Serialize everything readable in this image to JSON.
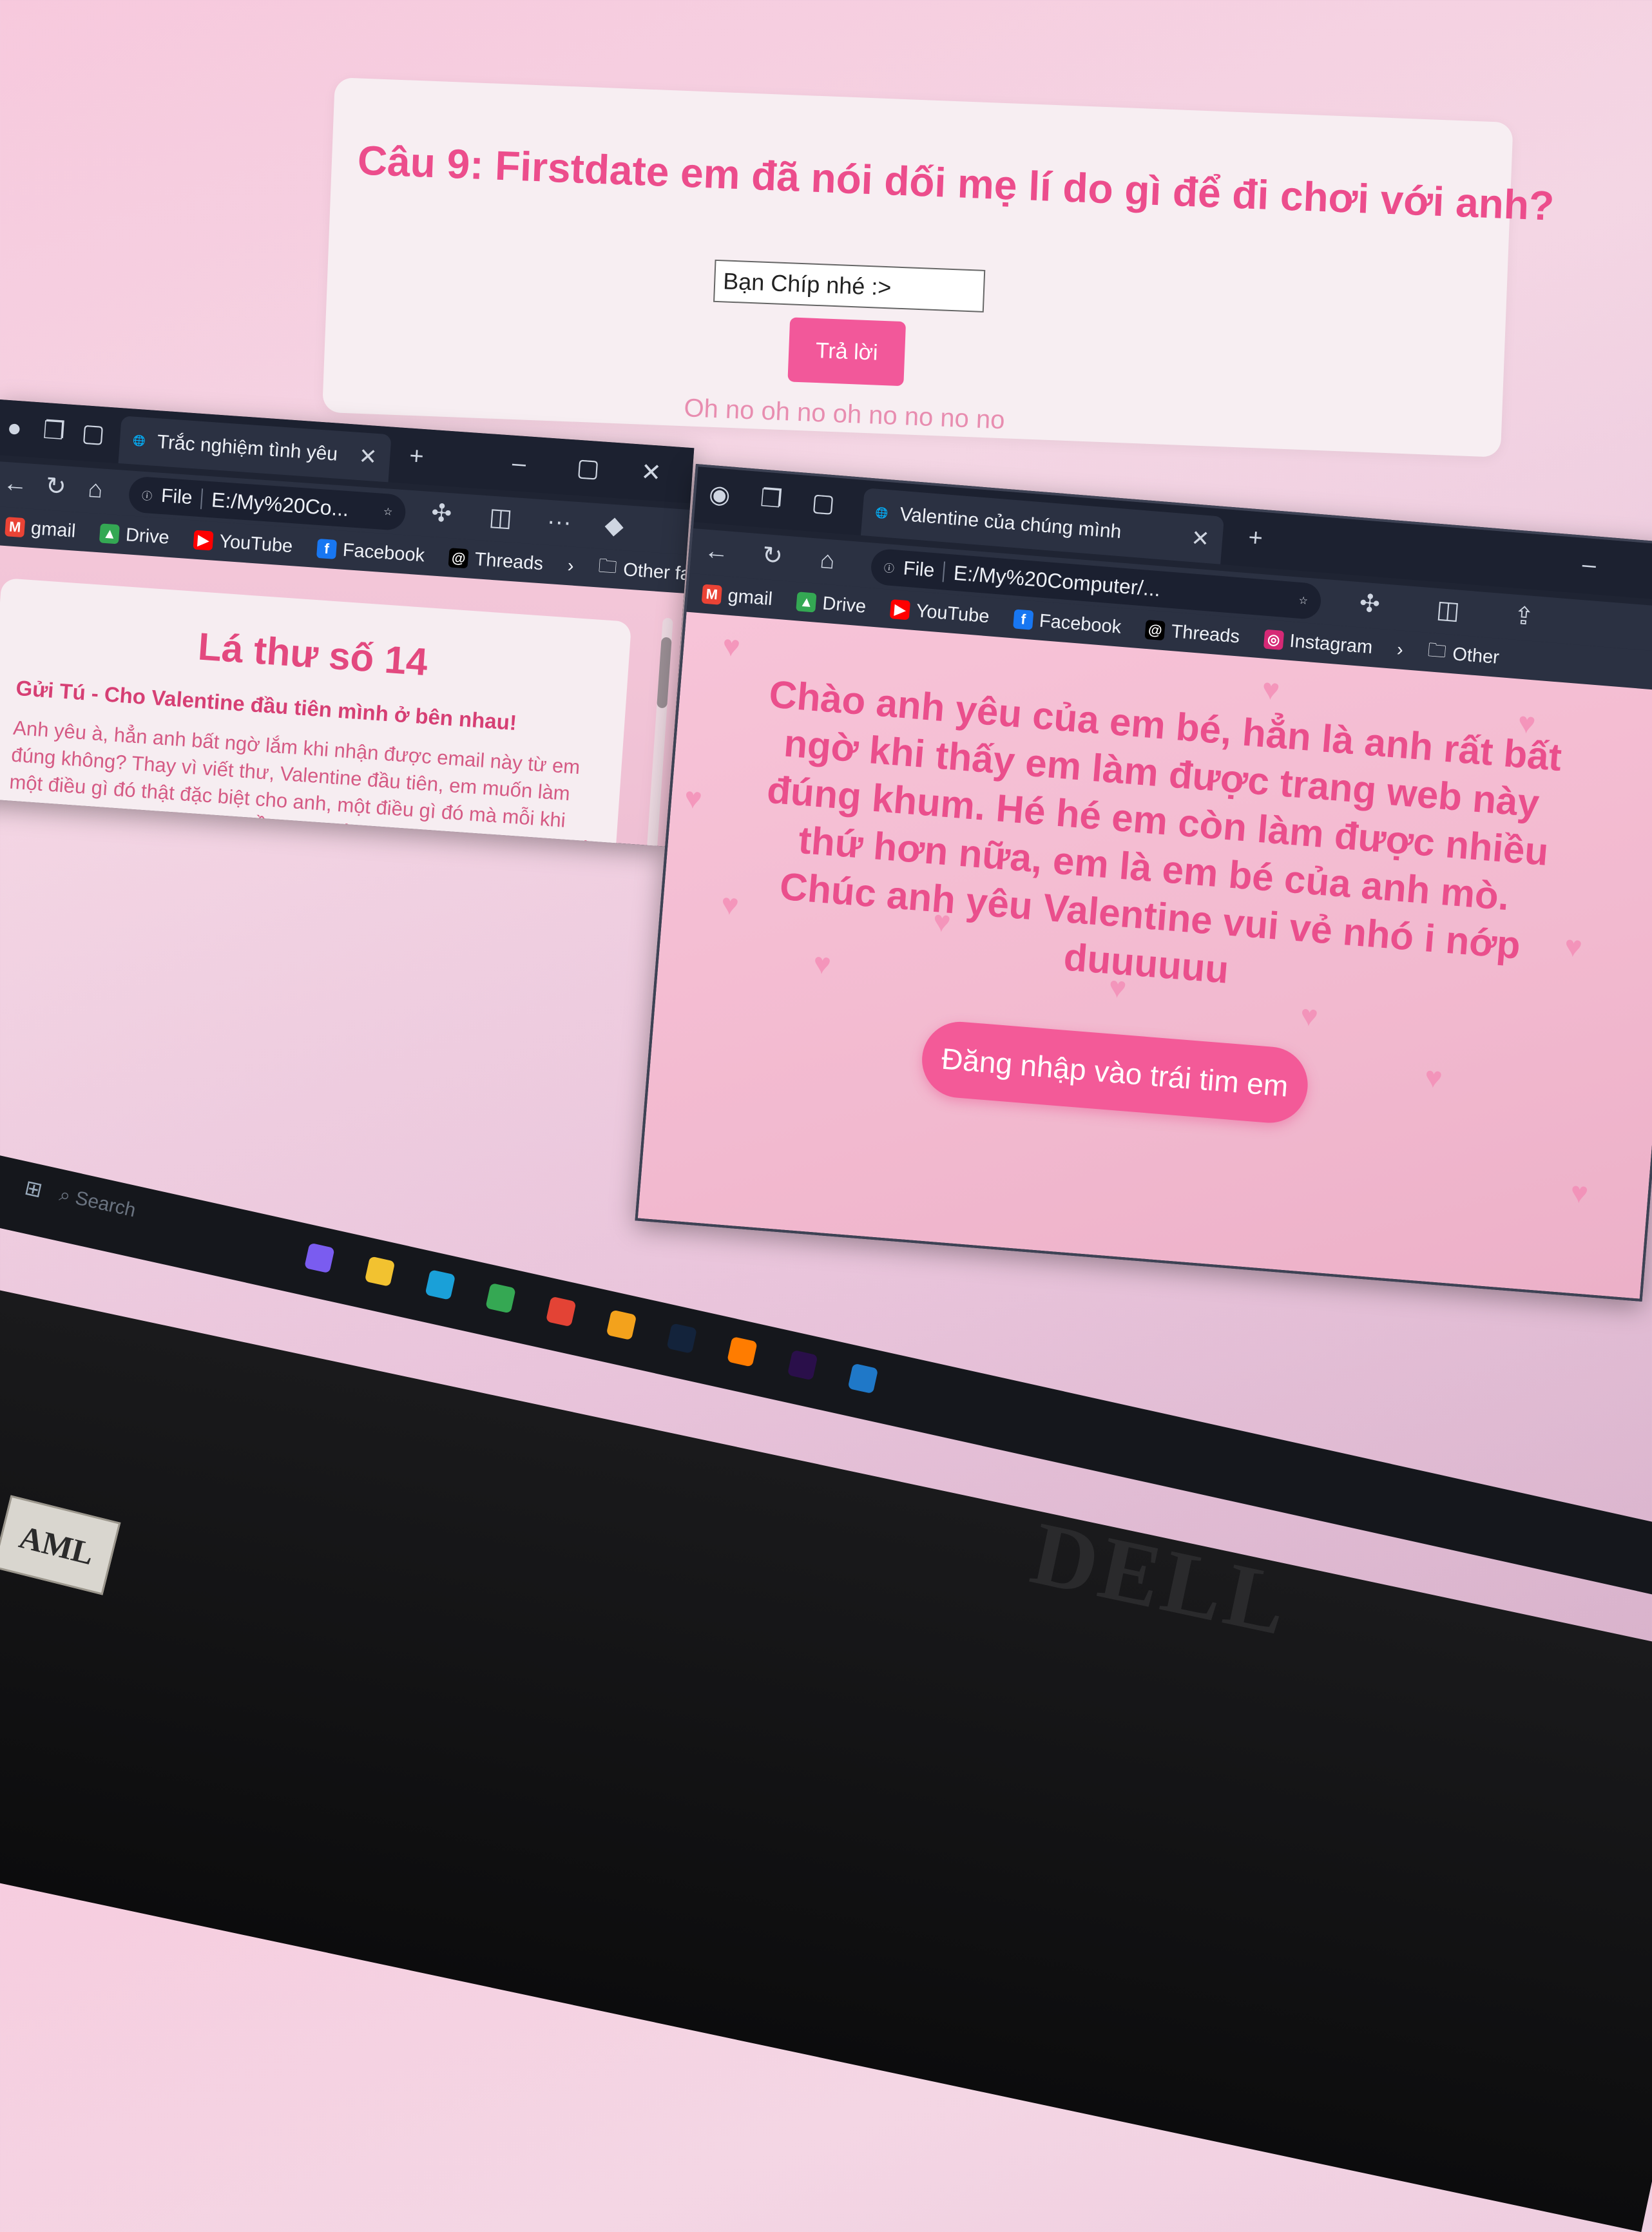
{
  "quiz": {
    "question": "Câu 9: Firstdate em đã nói dối mẹ lí do gì để đi chơi với anh?",
    "answer_value": "Bạn Chíp nhé :>",
    "submit_label": "Trả lời",
    "feedback": "Oh no oh no oh no no no no"
  },
  "left_window": {
    "tab_title": "Trắc nghiệm tình yêu",
    "url_scheme": "File",
    "url": "E:/My%20Co...",
    "bookmarks": [
      "gmail",
      "Drive",
      "YouTube",
      "Facebook",
      "Threads"
    ],
    "other_favorites": "Other favorites",
    "letter": {
      "title": "Lá thư số 14",
      "subtitle": "Gửi Tú - Cho Valentine đầu tiên mình ở bên nhau!",
      "body": "Anh yêu à, hẳn anh bất ngờ lắm khi nhận được email này từ em đúng không? Thay vì viết thư, Valentine đầu tiên, em muốn làm một điều gì đó thật đặc biệt cho anh, một điều gì đó mà mỗi khi nhìn lại, mình sẽ cảm thán “Ồ thì ra đối phương đã vì mình mà cố gắng làm những điều như thế!”"
    }
  },
  "right_window": {
    "tab_title": "Valentine của chúng mình",
    "url_scheme": "File",
    "url": "E:/My%20Computer/...",
    "bookmarks": [
      "gmail",
      "Drive",
      "YouTube",
      "Facebook",
      "Threads",
      "Instagram"
    ],
    "other_favorites": "Other",
    "message": "Chào anh yêu của em bé, hẳn là anh rất bất ngờ khi thấy em làm được trang web này đúng khum. Hé hé em còn làm được nhiều thứ hơn nữa, em là em bé của anh mò. Chúc anh yêu Valentine vui vẻ nhó i nớp duuuuuu",
    "button_label": "Đăng nhập vào trái tim em"
  },
  "taskbar": {
    "search_placeholder": "Search"
  },
  "hardware": {
    "monitor_brand": "DELL",
    "sticker": "AML"
  },
  "colors": {
    "accent_pink": "#ec4d8c",
    "button_pink": "#f35a98",
    "browser_dark": "#1f2433"
  }
}
